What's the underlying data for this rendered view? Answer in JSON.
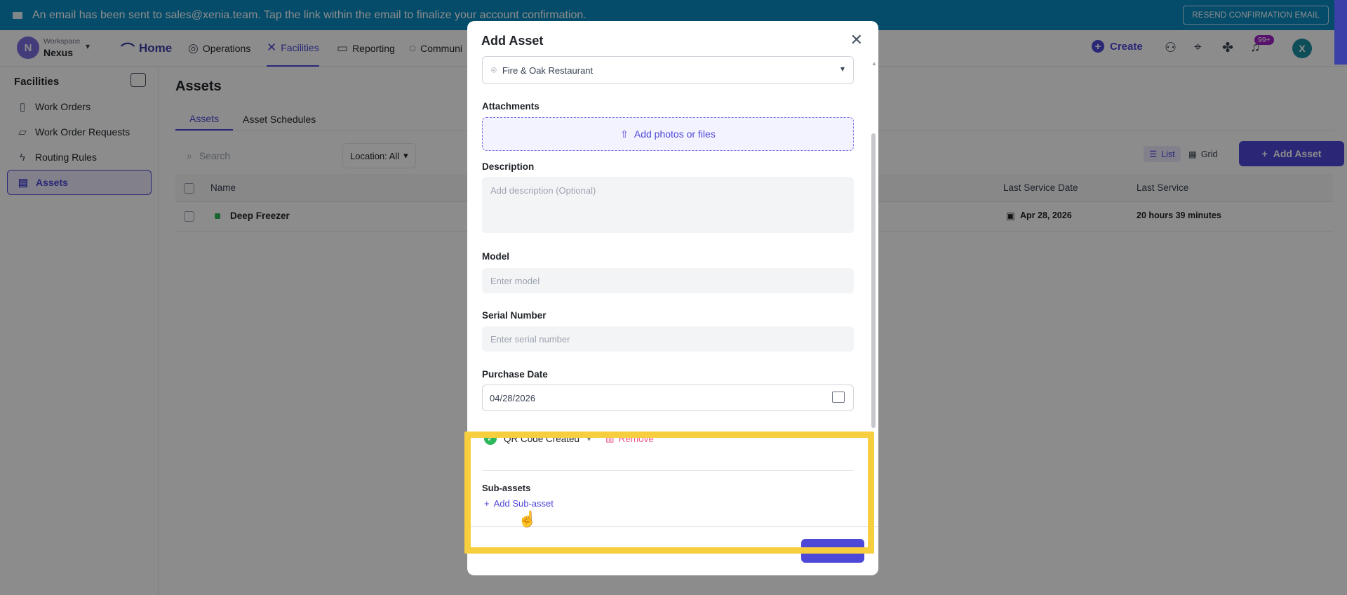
{
  "banner": {
    "message": "An email has been sent to sales@xenia.team. Tap the link within the email to finalize your account confirmation.",
    "resend_label": "RESEND CONFIRMATION EMAIL"
  },
  "workspace": {
    "label": "Workspace",
    "name": "Nexus",
    "initial": "N"
  },
  "nav": {
    "home": "Home",
    "operations": "Operations",
    "facilities": "Facilities",
    "reporting": "Reporting",
    "communication": "Communi",
    "create": "Create",
    "notifications_badge": "99+",
    "user_initial": "X"
  },
  "sidebar": {
    "title": "Facilities",
    "items": [
      {
        "label": "Work Orders"
      },
      {
        "label": "Work Order Requests"
      },
      {
        "label": "Routing Rules"
      },
      {
        "label": "Assets"
      }
    ]
  },
  "main": {
    "title": "Assets",
    "tabs": [
      "Assets",
      "Asset Schedules"
    ],
    "search_placeholder": "Search",
    "location_filter": "Location: All",
    "view_list": "List",
    "view_grid": "Grid",
    "add_asset": "Add Asset",
    "columns": {
      "name": "Name",
      "last_service_date": "Last Service Date",
      "last_service": "Last Service"
    },
    "rows": [
      {
        "name": "Deep Freezer",
        "last_service_date": "Apr 28, 2026",
        "last_service": "20 hours 39 minutes"
      }
    ]
  },
  "modal": {
    "title": "Add Asset",
    "location_value": "Fire & Oak Restaurant",
    "attachments_label": "Attachments",
    "upload_label": "Add photos or files",
    "description_label": "Description",
    "description_placeholder": "Add description (Optional)",
    "model_label": "Model",
    "model_placeholder": "Enter model",
    "serial_label": "Serial Number",
    "serial_placeholder": "Enter serial number",
    "purchase_date_label": "Purchase Date",
    "purchase_date_value": "04/28/2026",
    "qr_status": "QR Code Created",
    "remove_label": "Remove",
    "subassets_label": "Sub-assets",
    "add_subasset_label": "Add Sub-asset"
  },
  "colors": {
    "banner": "#0a8ac2",
    "accent": "#4e48d8",
    "highlight": "#f7cf3e",
    "success": "#2eb85c",
    "danger": "#e9588c"
  }
}
